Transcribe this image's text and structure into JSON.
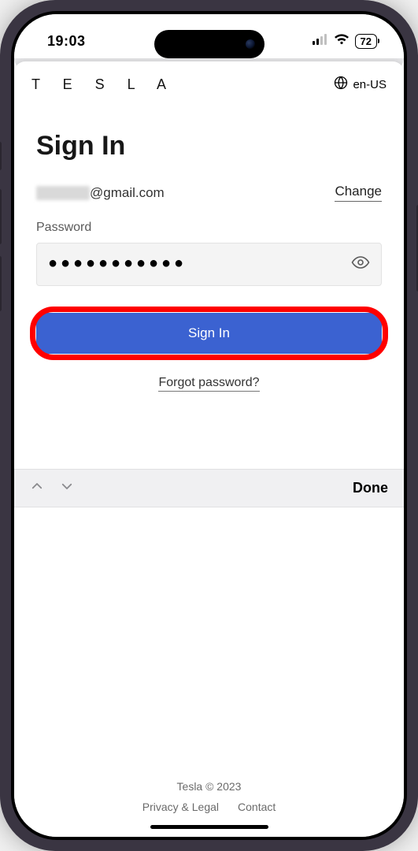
{
  "statusbar": {
    "time": "19:03",
    "battery": "72"
  },
  "header": {
    "logo": "T E S L A",
    "language": "en-US"
  },
  "signin": {
    "title": "Sign In",
    "email_domain": "@gmail.com",
    "change_label": "Change",
    "password_label": "Password",
    "password_value": "●●●●●●●●●●●",
    "button_label": "Sign In",
    "forgot_label": "Forgot password?"
  },
  "keyboard_accessory": {
    "done_label": "Done"
  },
  "footer": {
    "copyright": "Tesla © 2023",
    "privacy": "Privacy & Legal",
    "contact": "Contact"
  }
}
